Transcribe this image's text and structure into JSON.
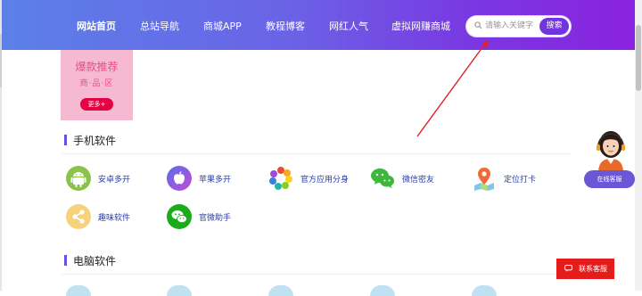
{
  "nav": {
    "items": [
      {
        "label": "网站首页",
        "active": true
      },
      {
        "label": "总站导航",
        "active": false
      },
      {
        "label": "商城APP",
        "active": false
      },
      {
        "label": "教程博客",
        "active": false
      },
      {
        "label": "网红人气",
        "active": false
      },
      {
        "label": "虚拟网赚商城",
        "active": false
      }
    ],
    "search": {
      "placeholder": "请输入关键字",
      "button": "搜索"
    }
  },
  "promo": {
    "title": "爆款推荐",
    "subtitle": "商·品·区",
    "button": "更多+"
  },
  "sections": {
    "mobile": {
      "title": "手机软件",
      "apps": [
        {
          "label": "安卓多开",
          "icon": "android-icon"
        },
        {
          "label": "苹果多开",
          "icon": "apple-icon"
        },
        {
          "label": "官方应用分身",
          "icon": "pinwheel-icon"
        },
        {
          "label": "微信密友",
          "icon": "wechat-icon"
        },
        {
          "label": "定位打卡",
          "icon": "map-pin-icon"
        },
        {
          "label": "趣味软件",
          "icon": "share-icon"
        },
        {
          "label": "官微助手",
          "icon": "wechat-helper-icon"
        }
      ]
    },
    "pc": {
      "title": "电脑软件"
    }
  },
  "service": {
    "online_label": "在线客服",
    "contact_label": "联系客服"
  },
  "colors": {
    "nav_start": "#5b80e8",
    "nav_end": "#8a22df",
    "accent": "#7233e2",
    "promo_bg": "#f5b9d2",
    "contact_red": "#e51c1c",
    "arrow_red": "#e0202a"
  }
}
